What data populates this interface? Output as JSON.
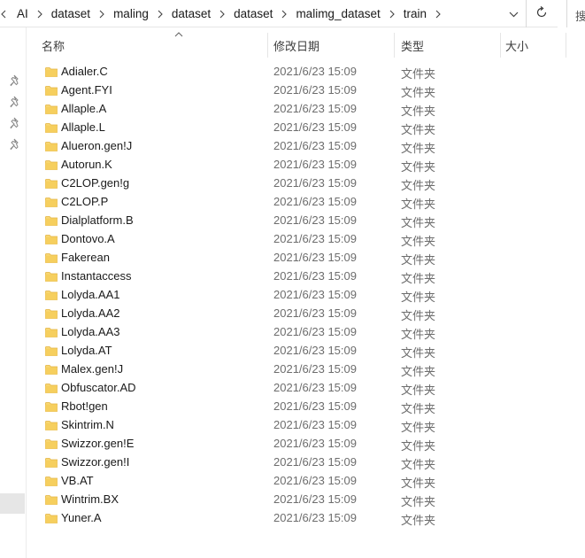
{
  "breadcrumb": {
    "items": [
      "AI",
      "dataset",
      "maling",
      "dataset",
      "dataset",
      "malimg_dataset",
      "train"
    ]
  },
  "search": {
    "placeholder": "搜"
  },
  "icons": {
    "lead_separator": "chevron-left-icon",
    "separator": "chevron-right-icon",
    "dropdown": "chevron-down-icon",
    "refresh": "refresh-icon",
    "pin": "pin-icon",
    "folder": "folder-icon",
    "sort": "sort-ascending-icon"
  },
  "columns": {
    "name": "名称",
    "modified": "修改日期",
    "type": "类型",
    "size": "大小"
  },
  "colors": {
    "folder_yellow": "#f8d775",
    "folder_dark": "#e3b23c",
    "selected_nav": "#e6e6e6",
    "meta_text": "#6d6d6d"
  },
  "files": [
    {
      "name": "Adialer.C",
      "modified": "2021/6/23 15:09",
      "type": "文件夹"
    },
    {
      "name": "Agent.FYI",
      "modified": "2021/6/23 15:09",
      "type": "文件夹"
    },
    {
      "name": "Allaple.A",
      "modified": "2021/6/23 15:09",
      "type": "文件夹"
    },
    {
      "name": "Allaple.L",
      "modified": "2021/6/23 15:09",
      "type": "文件夹"
    },
    {
      "name": "Alueron.gen!J",
      "modified": "2021/6/23 15:09",
      "type": "文件夹"
    },
    {
      "name": "Autorun.K",
      "modified": "2021/6/23 15:09",
      "type": "文件夹"
    },
    {
      "name": "C2LOP.gen!g",
      "modified": "2021/6/23 15:09",
      "type": "文件夹"
    },
    {
      "name": "C2LOP.P",
      "modified": "2021/6/23 15:09",
      "type": "文件夹"
    },
    {
      "name": "Dialplatform.B",
      "modified": "2021/6/23 15:09",
      "type": "文件夹"
    },
    {
      "name": "Dontovo.A",
      "modified": "2021/6/23 15:09",
      "type": "文件夹"
    },
    {
      "name": "Fakerean",
      "modified": "2021/6/23 15:09",
      "type": "文件夹"
    },
    {
      "name": "Instantaccess",
      "modified": "2021/6/23 15:09",
      "type": "文件夹"
    },
    {
      "name": "Lolyda.AA1",
      "modified": "2021/6/23 15:09",
      "type": "文件夹"
    },
    {
      "name": "Lolyda.AA2",
      "modified": "2021/6/23 15:09",
      "type": "文件夹"
    },
    {
      "name": "Lolyda.AA3",
      "modified": "2021/6/23 15:09",
      "type": "文件夹"
    },
    {
      "name": "Lolyda.AT",
      "modified": "2021/6/23 15:09",
      "type": "文件夹"
    },
    {
      "name": "Malex.gen!J",
      "modified": "2021/6/23 15:09",
      "type": "文件夹"
    },
    {
      "name": "Obfuscator.AD",
      "modified": "2021/6/23 15:09",
      "type": "文件夹"
    },
    {
      "name": "Rbot!gen",
      "modified": "2021/6/23 15:09",
      "type": "文件夹"
    },
    {
      "name": "Skintrim.N",
      "modified": "2021/6/23 15:09",
      "type": "文件夹"
    },
    {
      "name": "Swizzor.gen!E",
      "modified": "2021/6/23 15:09",
      "type": "文件夹"
    },
    {
      "name": "Swizzor.gen!I",
      "modified": "2021/6/23 15:09",
      "type": "文件夹"
    },
    {
      "name": "VB.AT",
      "modified": "2021/6/23 15:09",
      "type": "文件夹"
    },
    {
      "name": "Wintrim.BX",
      "modified": "2021/6/23 15:09",
      "type": "文件夹"
    },
    {
      "name": "Yuner.A",
      "modified": "2021/6/23 15:09",
      "type": "文件夹"
    }
  ]
}
